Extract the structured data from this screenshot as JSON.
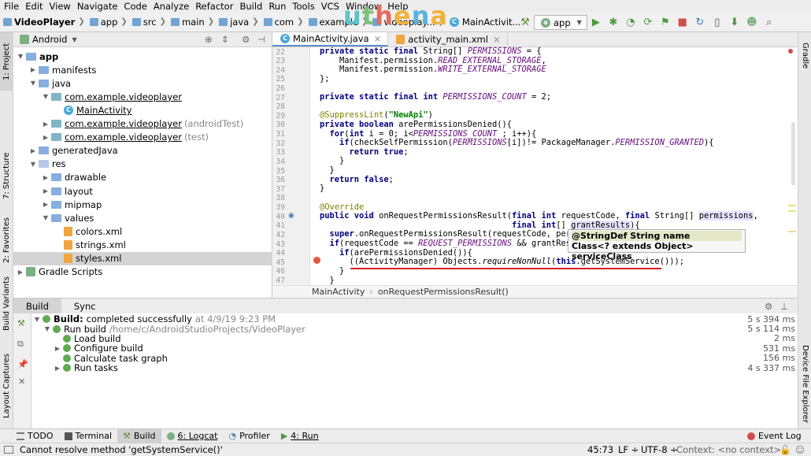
{
  "menu": [
    "File",
    "Edit",
    "View",
    "Navigate",
    "Code",
    "Analyze",
    "Refactor",
    "Build",
    "Run",
    "Tools",
    "VCS",
    "Window",
    "Help"
  ],
  "breadcrumbs": [
    "VideoPlayer",
    "app",
    "src",
    "main",
    "java",
    "com",
    "example",
    "videoplay...",
    "MainActivit..."
  ],
  "logo": [
    "u",
    "t",
    "h",
    "e",
    "n",
    "a"
  ],
  "run_config": "app",
  "left_strip": {
    "project": "1: Project",
    "structure": "7: Structure",
    "favorites": "2: Favorites",
    "build_variants": "Build Variants",
    "layout_captures": "Layout Captures"
  },
  "right_strip": {
    "gradle": "Gradle",
    "device_explorer": "Device File Explorer"
  },
  "project_view": "Android",
  "tree": [
    {
      "label": "app",
      "level": 0,
      "type": "folder",
      "bold": true
    },
    {
      "label": "manifests",
      "level": 1,
      "type": "folder"
    },
    {
      "label": "java",
      "level": 1,
      "type": "folder"
    },
    {
      "label": "com.example.videoplayer",
      "level": 2,
      "type": "pkg"
    },
    {
      "label": "MainActivity",
      "level": 3,
      "type": "class"
    },
    {
      "label": "com.example.videoplayer",
      "hint": "(androidTest)",
      "level": 2,
      "type": "pkg"
    },
    {
      "label": "com.example.videoplayer",
      "hint": "(test)",
      "level": 2,
      "type": "pkg"
    },
    {
      "label": "generatedJava",
      "level": 1,
      "type": "folder"
    },
    {
      "label": "res",
      "level": 1,
      "type": "res"
    },
    {
      "label": "drawable",
      "level": 2,
      "type": "folder"
    },
    {
      "label": "layout",
      "level": 2,
      "type": "folder"
    },
    {
      "label": "mipmap",
      "level": 2,
      "type": "folder"
    },
    {
      "label": "values",
      "level": 2,
      "type": "folder"
    },
    {
      "label": "colors.xml",
      "level": 3,
      "type": "xml"
    },
    {
      "label": "strings.xml",
      "level": 3,
      "type": "xml"
    },
    {
      "label": "styles.xml",
      "level": 3,
      "type": "xml",
      "selected": true
    },
    {
      "label": "Gradle Scripts",
      "level": 0,
      "type": "gradle"
    }
  ],
  "tabs": [
    {
      "label": "MainActivity.java",
      "active": true
    },
    {
      "label": "activity_main.xml",
      "active": false
    }
  ],
  "line_numbers": [
    "22",
    "23",
    "24",
    "25",
    "26",
    "27",
    "28",
    "29",
    "30",
    "31",
    "32",
    "33",
    "34",
    "35",
    "36",
    "37",
    "38",
    "39",
    "40",
    "41",
    "42",
    "43",
    "44",
    "45",
    "46",
    "47"
  ],
  "tooltip": {
    "line1": "@StringDef String name",
    "line2": "Class<? extends Object> serviceClass"
  },
  "editor_breadcrumb": [
    "MainActivity",
    "onRequestPermissionsResult()"
  ],
  "build_tabs": [
    "Build",
    "Sync"
  ],
  "build": [
    {
      "label": "Build:",
      "detail": "completed successfully",
      "path": "at 4/9/19 9:23 PM",
      "time": "5 s 394 ms",
      "level": 0
    },
    {
      "label": "Run build",
      "path": "/home/c/AndroidStudioProjects/VideoPlayer",
      "time": "5 s 114 ms",
      "level": 1
    },
    {
      "label": "Load build",
      "time": "2 ms",
      "level": 2
    },
    {
      "label": "Configure build",
      "time": "531 ms",
      "level": 2
    },
    {
      "label": "Calculate task graph",
      "time": "156 ms",
      "level": 2
    },
    {
      "label": "Run tasks",
      "time": "4 s 337 ms",
      "level": 2
    }
  ],
  "bottom_tools": [
    "TODO",
    "Terminal",
    "Build",
    "6: Logcat",
    "Profiler",
    "4: Run"
  ],
  "event_log": "Event Log",
  "status": {
    "message": "Cannot resolve method 'getSystemService()'",
    "position": "45:73",
    "line_sep": "LF ÷",
    "encoding": "UTF-8 ÷",
    "context": "Context: <no context>"
  },
  "colors": {
    "accent": "#5a8fd0",
    "error": "#d81f1f",
    "ok": "#5fab4f"
  }
}
